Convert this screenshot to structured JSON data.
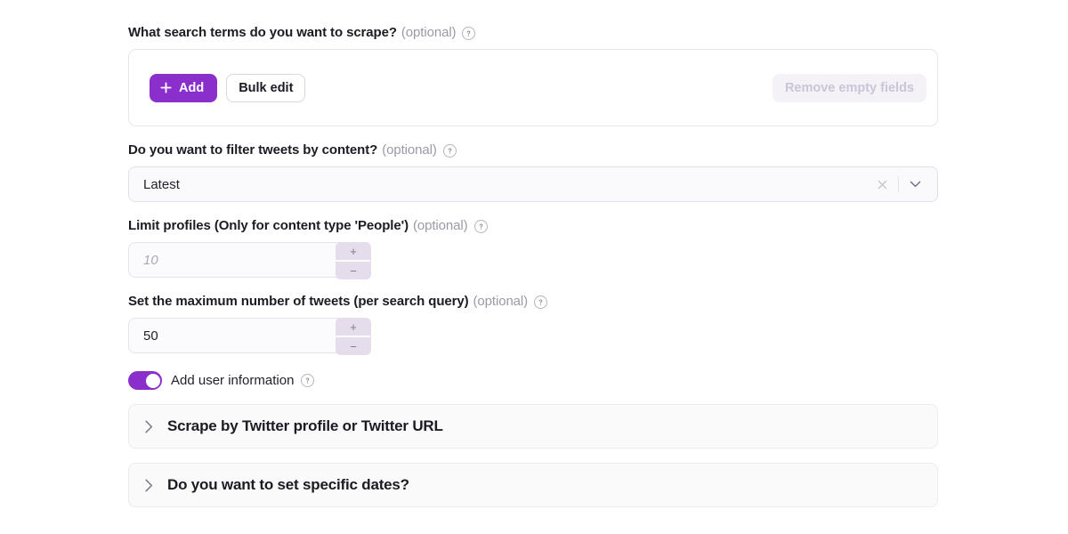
{
  "colors": {
    "accent_purple": "#8b2fcc",
    "stepper_bg": "#e5dcec",
    "disabled_btn_bg": "#f4f1f7",
    "disabled_btn_text": "#cdc3d8",
    "text_primary": "#1b1b23",
    "optional_gray": "#9a9aa8"
  },
  "fields": {
    "search_terms": {
      "label": "What search terms do you want to scrape?",
      "optional": "(optional)",
      "help_icon": "question-circle-icon",
      "add_button": "Add",
      "add_icon": "plus-icon",
      "bulk_edit_button": "Bulk edit",
      "remove_empty_button": "Remove empty fields"
    },
    "filter_content": {
      "label": "Do you want to filter tweets by content?",
      "optional": "(optional)",
      "help_icon": "question-circle-icon",
      "value": "Latest",
      "clear_icon": "close-icon",
      "caret_icon": "chevron-down-icon"
    },
    "limit_profiles": {
      "label": "Limit profiles (Only for content type 'People')",
      "optional": "(optional)",
      "help_icon": "question-circle-icon",
      "placeholder": "10",
      "value": "",
      "increment_label": "+",
      "decrement_label": "−"
    },
    "max_tweets": {
      "label": "Set the maximum number of tweets (per search query)",
      "optional": "(optional)",
      "help_icon": "question-circle-icon",
      "value": "50",
      "increment_label": "+",
      "decrement_label": "−"
    },
    "add_user_information": {
      "label": "Add user information",
      "help_icon": "question-circle-icon",
      "state": "on"
    }
  },
  "accordions": [
    {
      "title": "Scrape by Twitter profile or Twitter URL",
      "icon": "chevron-right-icon",
      "expanded": false
    },
    {
      "title": "Do you want to set specific dates?",
      "icon": "chevron-right-icon",
      "expanded": false
    }
  ]
}
